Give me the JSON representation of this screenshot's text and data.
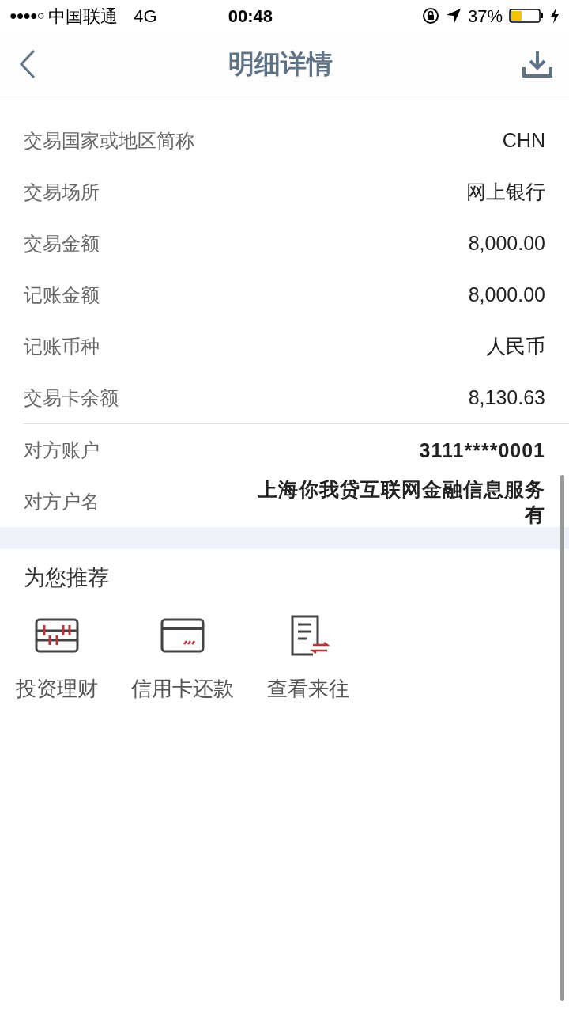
{
  "status_bar": {
    "signal": "●●●●○",
    "carrier": "中国联通",
    "network": "4G",
    "time": "00:48",
    "battery": "37%"
  },
  "header": {
    "title": "明细详情"
  },
  "details": [
    {
      "label": "交易国家或地区简称",
      "value": "CHN"
    },
    {
      "label": "交易场所",
      "value": "网上银行"
    },
    {
      "label": "交易金额",
      "value": "8,000.00"
    },
    {
      "label": "记账金额",
      "value": "8,000.00"
    },
    {
      "label": "记账币种",
      "value": "人民币"
    },
    {
      "label": "交易卡余额",
      "value": "8,130.63"
    }
  ],
  "counterparty": [
    {
      "label": "对方账户",
      "value": "3111****0001"
    },
    {
      "label": "对方户名",
      "value": "上海你我贷互联网金融信息服务有"
    }
  ],
  "recommend": {
    "title": "为您推荐",
    "items": [
      {
        "kind": "abacus",
        "label": "投资理财"
      },
      {
        "kind": "card",
        "label": "信用卡还款"
      },
      {
        "kind": "document",
        "label": "查看来往"
      }
    ]
  }
}
